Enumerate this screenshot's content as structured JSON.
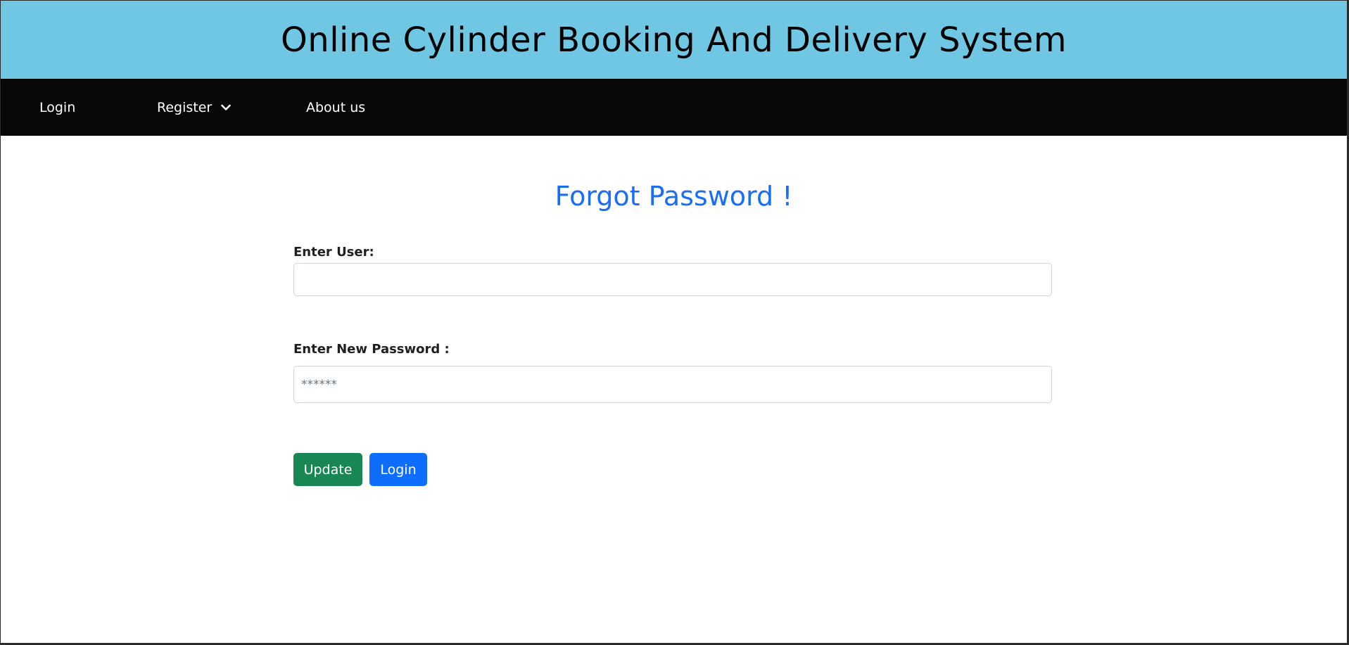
{
  "header": {
    "title": "Online Cylinder Booking And Delivery System"
  },
  "nav": {
    "login_label": "Login",
    "register_label": "Register",
    "about_label": "About us"
  },
  "form": {
    "heading": "Forgot Password !",
    "user_label": "Enter User:",
    "user_value": "",
    "user_placeholder": "",
    "password_label": "Enter New Password :",
    "password_value": "",
    "password_placeholder": "******",
    "update_button": "Update",
    "login_button": "Login"
  },
  "icons": {
    "register_dropdown": "chevron-down-icon"
  },
  "colors": {
    "banner_bg": "#70c7e3",
    "nav_bg": "#080808",
    "heading": "#1a6ef5",
    "update_button": "#198754",
    "login_button": "#0d6efd"
  }
}
